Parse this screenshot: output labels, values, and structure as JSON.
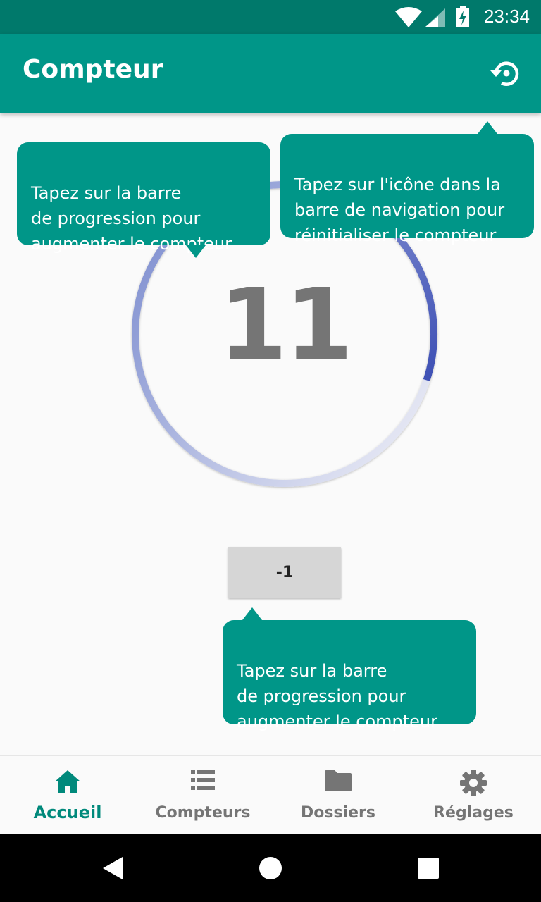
{
  "status_bar": {
    "time": "23:34",
    "icons": [
      "wifi-icon",
      "signal-icon",
      "battery-charging-icon"
    ]
  },
  "app_bar": {
    "title": "Compteur",
    "reset_icon": "restore-icon"
  },
  "counter": {
    "value": "11",
    "progress_fraction": 0.3
  },
  "decrement_button": {
    "label": "-1"
  },
  "tooltips": {
    "progress_tip": "Tapez sur la barre\nde progression pour\naugmenter le compteur",
    "reset_tip": "Tapez sur l'icône dans la\nbarre de navigation pour\nréinitialiser le compteur",
    "button_tip": "Tapez sur la barre\nde progression pour\naugmenter le compteur"
  },
  "bottom_nav": {
    "items": [
      {
        "label": "Accueil",
        "icon": "home-icon",
        "active": true
      },
      {
        "label": "Compteurs",
        "icon": "list-icon",
        "active": false
      },
      {
        "label": "Dossiers",
        "icon": "folder-icon",
        "active": false
      },
      {
        "label": "Réglages",
        "icon": "settings-icon",
        "active": false
      }
    ]
  },
  "colors": {
    "primary": "#009688",
    "primary_dark": "#00796b",
    "progress_start": "#3f51b5",
    "progress_end": "#e8eaf6",
    "counter_text": "#757575"
  }
}
